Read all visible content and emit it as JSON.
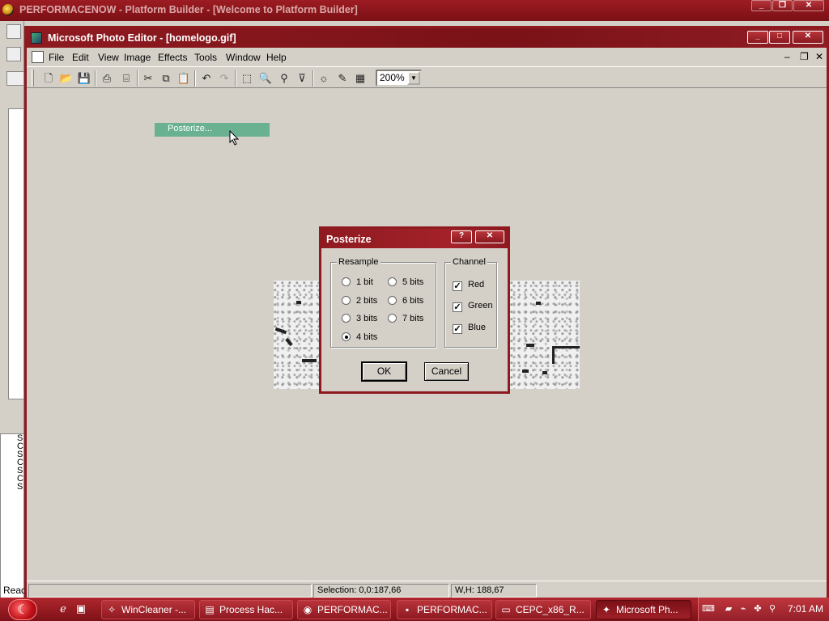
{
  "outer_window": {
    "title": "PERFORMACENOW - Platform Builder - [Welcome to Platform Builder]",
    "left_fragments": [
      "S",
      "C",
      "S",
      "C",
      "S",
      "C",
      "S"
    ],
    "status_fragment": "Read"
  },
  "photo_editor": {
    "title": "Microsoft Photo Editor - [homelogo.gif]",
    "menus": [
      "File",
      "Edit",
      "View",
      "Image",
      "Effects",
      "Tools",
      "Window",
      "Help"
    ],
    "zoom": "200%",
    "tooltip": "Posterize...",
    "status": {
      "selection": "Selection: 0,0:187,66",
      "wh": "W,H: 188,67"
    }
  },
  "dialog": {
    "title": "Posterize",
    "help_btn": "?",
    "close_btn": "✕",
    "resample": {
      "legend": "Resample",
      "options": [
        "1 bit",
        "2 bits",
        "3 bits",
        "4 bits",
        "5 bits",
        "6 bits",
        "7 bits"
      ],
      "selected": "4 bits"
    },
    "channel": {
      "legend": "Channel",
      "options": [
        {
          "label": "Red",
          "checked": true
        },
        {
          "label": "Green",
          "checked": true
        },
        {
          "label": "Blue",
          "checked": true
        }
      ]
    },
    "ok": "OK",
    "cancel": "Cancel"
  },
  "taskbar": {
    "tasks": [
      {
        "label": "WinCleaner -...",
        "icon": "broom-icon"
      },
      {
        "label": "Process Hac...",
        "icon": "monitor-icon"
      },
      {
        "label": "PERFORMAC...",
        "icon": "platform-builder-icon"
      },
      {
        "label": "PERFORMAC...",
        "icon": "console-icon"
      },
      {
        "label": "CEPC_x86_R...",
        "icon": "folder-icon"
      },
      {
        "label": "Microsoft Ph...",
        "icon": "photo-editor-icon"
      }
    ],
    "clock": "7:01 AM"
  },
  "colors": {
    "titlebar": "#8e1a20",
    "tooltip": "#6ab192",
    "taskbar": "#a0222a"
  }
}
